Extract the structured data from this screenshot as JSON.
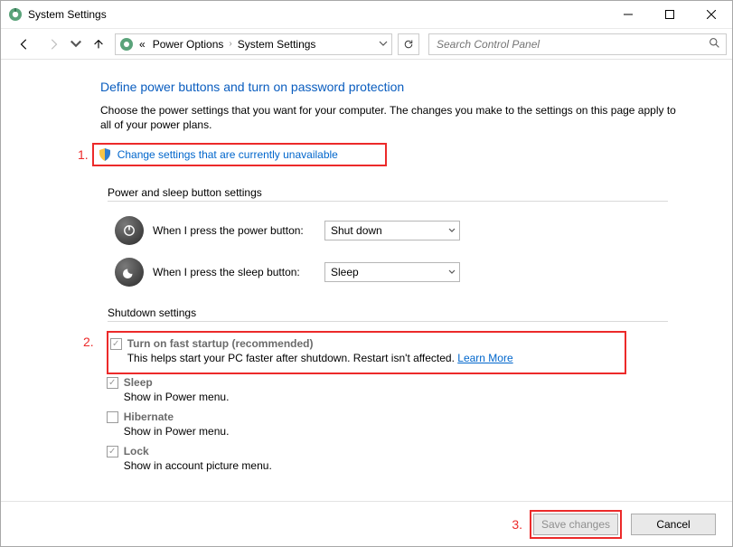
{
  "window": {
    "title": "System Settings"
  },
  "breadcrumb": {
    "root_marker": "«",
    "parent": "Power Options",
    "current": "System Settings"
  },
  "search": {
    "placeholder": "Search Control Panel"
  },
  "page": {
    "heading": "Define power buttons and turn on password protection",
    "description": "Choose the power settings that you want for your computer. The changes you make to the settings on this page apply to all of your power plans.",
    "admin_link": "Change settings that are currently unavailable"
  },
  "annotations": {
    "one": "1.",
    "two": "2.",
    "three": "3."
  },
  "section_buttons": {
    "header": "Power and sleep button settings",
    "rows": [
      {
        "label": "When I press the power button:",
        "value": "Shut down"
      },
      {
        "label": "When I press the sleep button:",
        "value": "Sleep"
      }
    ]
  },
  "section_shutdown": {
    "header": "Shutdown settings",
    "fast_startup": {
      "label": "Turn on fast startup (recommended)",
      "checked": true,
      "sub": "This helps start your PC faster after shutdown. Restart isn't affected.",
      "learn": "Learn More"
    },
    "sleep": {
      "label": "Sleep",
      "checked": true,
      "sub": "Show in Power menu."
    },
    "hibernate": {
      "label": "Hibernate",
      "checked": false,
      "sub": "Show in Power menu."
    },
    "lock": {
      "label": "Lock",
      "checked": true,
      "sub": "Show in account picture menu."
    }
  },
  "footer": {
    "save": "Save changes",
    "cancel": "Cancel"
  }
}
